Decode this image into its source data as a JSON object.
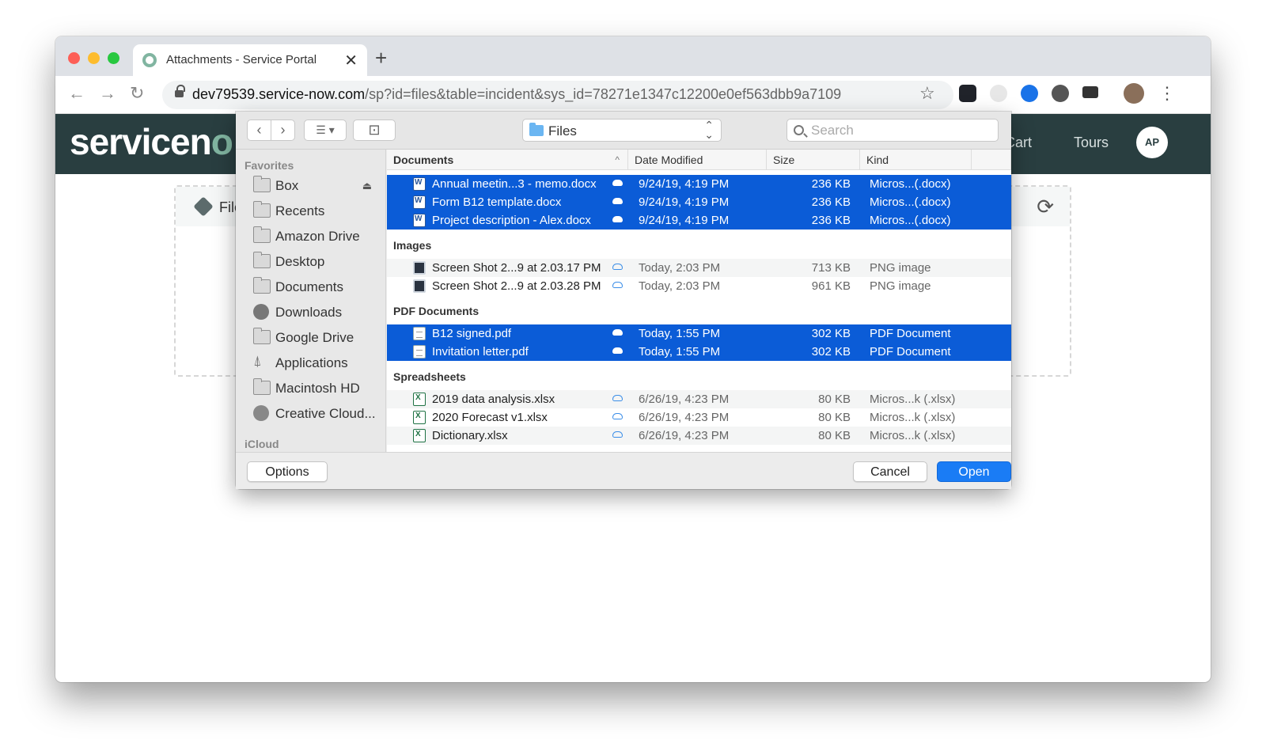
{
  "browser": {
    "tab_title": "Attachments - Service Portal",
    "close_glyph": "✕",
    "newtab_glyph": "+",
    "url_host": "dev79539.service-now.com",
    "url_path": "/sp?id=files&table=incident&sys_id=78271e1347c12200e0ef563dbb9a7109",
    "back_glyph": "←",
    "forward_glyph": "→",
    "reload_glyph": "↻",
    "star_glyph": "☆",
    "menu_glyph": "⋮"
  },
  "portal": {
    "logo_text": "servicen",
    "logo_accent": "o",
    "cart_label": "Cart",
    "tours_label": "Tours",
    "avatar_initials": "AP",
    "files_label": "File",
    "refresh_glyph": "⟳"
  },
  "dialog": {
    "location": "Files",
    "search_placeholder": "Search",
    "toolbar": {
      "back": "‹",
      "forward": "›",
      "view": "☰ ▾",
      "new_folder": "⊡"
    },
    "sidebar": {
      "favorites_heading": "Favorites",
      "icloud_heading": "iCloud",
      "items": [
        {
          "label": "Box",
          "icon": "folder-icon",
          "eject": "⏏"
        },
        {
          "label": "Recents",
          "icon": "recents-icon"
        },
        {
          "label": "Amazon Drive",
          "icon": "folder-icon"
        },
        {
          "label": "Desktop",
          "icon": "desktop-icon"
        },
        {
          "label": "Documents",
          "icon": "documents-icon"
        },
        {
          "label": "Downloads",
          "icon": "downloads-icon"
        },
        {
          "label": "Google Drive",
          "icon": "folder-icon"
        },
        {
          "label": "Applications",
          "icon": "applications-icon"
        },
        {
          "label": "Macintosh HD",
          "icon": "disk-icon"
        },
        {
          "label": "Creative Cloud...",
          "icon": "creative-cloud-icon"
        }
      ]
    },
    "columns": {
      "name": "Documents",
      "sort_glyph": "^",
      "date": "Date Modified",
      "size": "Size",
      "kind": "Kind"
    },
    "groups": {
      "images": "Images",
      "pdf": "PDF Documents",
      "spreadsheets": "Spreadsheets"
    },
    "files": [
      {
        "name": "Annual meetin...3 - memo.docx",
        "date": "9/24/19, 4:19 PM",
        "size": "236 KB",
        "kind": "Micros...(.docx)",
        "type": "word",
        "selected": true
      },
      {
        "name": "Form B12 template.docx",
        "date": "9/24/19, 4:19 PM",
        "size": "236 KB",
        "kind": "Micros...(.docx)",
        "type": "word",
        "selected": true
      },
      {
        "name": "Project description - Alex.docx",
        "date": "9/24/19, 4:19 PM",
        "size": "236 KB",
        "kind": "Micros...(.docx)",
        "type": "word",
        "selected": true
      },
      {
        "name": "Screen Shot 2...9 at 2.03.17 PM",
        "date": "Today, 2:03 PM",
        "size": "713 KB",
        "kind": "PNG image",
        "type": "image",
        "selected": false
      },
      {
        "name": "Screen Shot 2...9 at 2.03.28 PM",
        "date": "Today, 2:03 PM",
        "size": "961 KB",
        "kind": "PNG image",
        "type": "image",
        "selected": false
      },
      {
        "name": "B12 signed.pdf",
        "date": "Today, 1:55 PM",
        "size": "302 KB",
        "kind": "PDF Document",
        "type": "pdf",
        "selected": true
      },
      {
        "name": "Invitation letter.pdf",
        "date": "Today, 1:55 PM",
        "size": "302 KB",
        "kind": "PDF Document",
        "type": "pdf",
        "selected": true
      },
      {
        "name": "2019 data analysis.xlsx",
        "date": "6/26/19, 4:23 PM",
        "size": "80 KB",
        "kind": "Micros...k (.xlsx)",
        "type": "excel",
        "selected": false
      },
      {
        "name": "2020 Forecast v1.xlsx",
        "date": "6/26/19, 4:23 PM",
        "size": "80 KB",
        "kind": "Micros...k (.xlsx)",
        "type": "excel",
        "selected": false
      },
      {
        "name": "Dictionary.xlsx",
        "date": "6/26/19, 4:23 PM",
        "size": "80 KB",
        "kind": "Micros...k (.xlsx)",
        "type": "excel",
        "selected": false
      }
    ],
    "options_label": "Options",
    "cancel_label": "Cancel",
    "open_label": "Open"
  },
  "colors": {
    "selection": "#0b5cd7",
    "primary_button": "#1a7cf5",
    "portal_header": "#293e40",
    "portal_accent": "#81b5a1"
  }
}
